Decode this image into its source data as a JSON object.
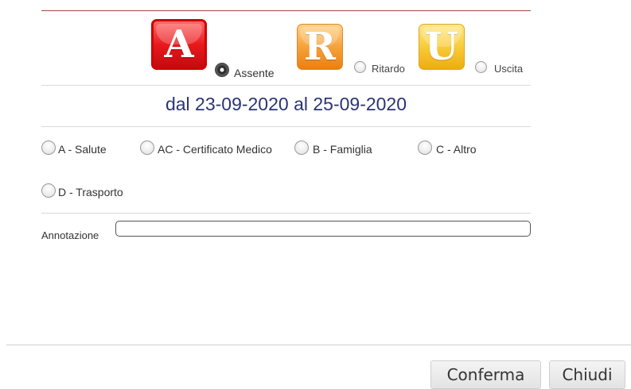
{
  "types": [
    {
      "letter": "A",
      "label": "Assente",
      "selected": true,
      "color": "#e8191c"
    },
    {
      "letter": "R",
      "label": "Ritardo",
      "selected": false,
      "color": "#f49a2e"
    },
    {
      "letter": "U",
      "label": "Uscita",
      "selected": false,
      "color": "#f6c232"
    }
  ],
  "date_range": "dal 23-09-2020 al 25-09-2020",
  "reasons": [
    {
      "label": "A - Salute",
      "selected": false
    },
    {
      "label": "AC - Certificato Medico",
      "selected": false
    },
    {
      "label": "B - Famiglia",
      "selected": false
    },
    {
      "label": "C - Altro",
      "selected": false
    },
    {
      "label": "D - Trasporto",
      "selected": false
    }
  ],
  "annotation": {
    "label": "Annotazione",
    "value": ""
  },
  "buttons": {
    "confirm": "Conferma",
    "close": "Chiudi"
  },
  "colors": {
    "accent_line": "#a04a3f",
    "date_text": "#2a3473"
  }
}
